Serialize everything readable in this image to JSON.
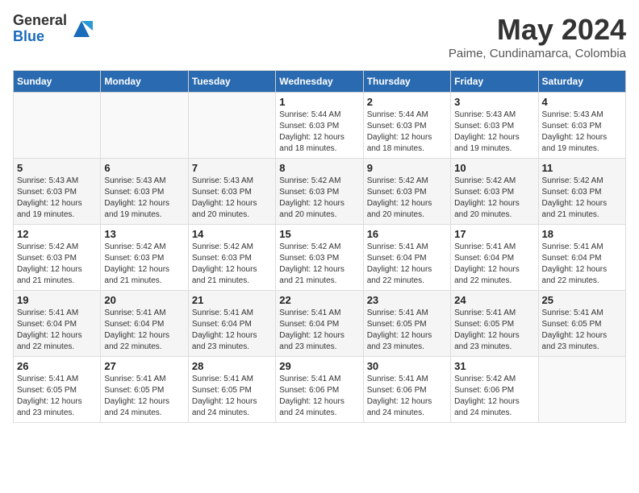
{
  "logo": {
    "general": "General",
    "blue": "Blue"
  },
  "header": {
    "month_year": "May 2024",
    "location": "Paime, Cundinamarca, Colombia"
  },
  "weekdays": [
    "Sunday",
    "Monday",
    "Tuesday",
    "Wednesday",
    "Thursday",
    "Friday",
    "Saturday"
  ],
  "weeks": [
    [
      {
        "day": "",
        "info": ""
      },
      {
        "day": "",
        "info": ""
      },
      {
        "day": "",
        "info": ""
      },
      {
        "day": "1",
        "info": "Sunrise: 5:44 AM\nSunset: 6:03 PM\nDaylight: 12 hours\nand 18 minutes."
      },
      {
        "day": "2",
        "info": "Sunrise: 5:44 AM\nSunset: 6:03 PM\nDaylight: 12 hours\nand 18 minutes."
      },
      {
        "day": "3",
        "info": "Sunrise: 5:43 AM\nSunset: 6:03 PM\nDaylight: 12 hours\nand 19 minutes."
      },
      {
        "day": "4",
        "info": "Sunrise: 5:43 AM\nSunset: 6:03 PM\nDaylight: 12 hours\nand 19 minutes."
      }
    ],
    [
      {
        "day": "5",
        "info": "Sunrise: 5:43 AM\nSunset: 6:03 PM\nDaylight: 12 hours\nand 19 minutes."
      },
      {
        "day": "6",
        "info": "Sunrise: 5:43 AM\nSunset: 6:03 PM\nDaylight: 12 hours\nand 19 minutes."
      },
      {
        "day": "7",
        "info": "Sunrise: 5:43 AM\nSunset: 6:03 PM\nDaylight: 12 hours\nand 20 minutes."
      },
      {
        "day": "8",
        "info": "Sunrise: 5:42 AM\nSunset: 6:03 PM\nDaylight: 12 hours\nand 20 minutes."
      },
      {
        "day": "9",
        "info": "Sunrise: 5:42 AM\nSunset: 6:03 PM\nDaylight: 12 hours\nand 20 minutes."
      },
      {
        "day": "10",
        "info": "Sunrise: 5:42 AM\nSunset: 6:03 PM\nDaylight: 12 hours\nand 20 minutes."
      },
      {
        "day": "11",
        "info": "Sunrise: 5:42 AM\nSunset: 6:03 PM\nDaylight: 12 hours\nand 21 minutes."
      }
    ],
    [
      {
        "day": "12",
        "info": "Sunrise: 5:42 AM\nSunset: 6:03 PM\nDaylight: 12 hours\nand 21 minutes."
      },
      {
        "day": "13",
        "info": "Sunrise: 5:42 AM\nSunset: 6:03 PM\nDaylight: 12 hours\nand 21 minutes."
      },
      {
        "day": "14",
        "info": "Sunrise: 5:42 AM\nSunset: 6:03 PM\nDaylight: 12 hours\nand 21 minutes."
      },
      {
        "day": "15",
        "info": "Sunrise: 5:42 AM\nSunset: 6:03 PM\nDaylight: 12 hours\nand 21 minutes."
      },
      {
        "day": "16",
        "info": "Sunrise: 5:41 AM\nSunset: 6:04 PM\nDaylight: 12 hours\nand 22 minutes."
      },
      {
        "day": "17",
        "info": "Sunrise: 5:41 AM\nSunset: 6:04 PM\nDaylight: 12 hours\nand 22 minutes."
      },
      {
        "day": "18",
        "info": "Sunrise: 5:41 AM\nSunset: 6:04 PM\nDaylight: 12 hours\nand 22 minutes."
      }
    ],
    [
      {
        "day": "19",
        "info": "Sunrise: 5:41 AM\nSunset: 6:04 PM\nDaylight: 12 hours\nand 22 minutes."
      },
      {
        "day": "20",
        "info": "Sunrise: 5:41 AM\nSunset: 6:04 PM\nDaylight: 12 hours\nand 22 minutes."
      },
      {
        "day": "21",
        "info": "Sunrise: 5:41 AM\nSunset: 6:04 PM\nDaylight: 12 hours\nand 23 minutes."
      },
      {
        "day": "22",
        "info": "Sunrise: 5:41 AM\nSunset: 6:04 PM\nDaylight: 12 hours\nand 23 minutes."
      },
      {
        "day": "23",
        "info": "Sunrise: 5:41 AM\nSunset: 6:05 PM\nDaylight: 12 hours\nand 23 minutes."
      },
      {
        "day": "24",
        "info": "Sunrise: 5:41 AM\nSunset: 6:05 PM\nDaylight: 12 hours\nand 23 minutes."
      },
      {
        "day": "25",
        "info": "Sunrise: 5:41 AM\nSunset: 6:05 PM\nDaylight: 12 hours\nand 23 minutes."
      }
    ],
    [
      {
        "day": "26",
        "info": "Sunrise: 5:41 AM\nSunset: 6:05 PM\nDaylight: 12 hours\nand 23 minutes."
      },
      {
        "day": "27",
        "info": "Sunrise: 5:41 AM\nSunset: 6:05 PM\nDaylight: 12 hours\nand 24 minutes."
      },
      {
        "day": "28",
        "info": "Sunrise: 5:41 AM\nSunset: 6:05 PM\nDaylight: 12 hours\nand 24 minutes."
      },
      {
        "day": "29",
        "info": "Sunrise: 5:41 AM\nSunset: 6:06 PM\nDaylight: 12 hours\nand 24 minutes."
      },
      {
        "day": "30",
        "info": "Sunrise: 5:41 AM\nSunset: 6:06 PM\nDaylight: 12 hours\nand 24 minutes."
      },
      {
        "day": "31",
        "info": "Sunrise: 5:42 AM\nSunset: 6:06 PM\nDaylight: 12 hours\nand 24 minutes."
      },
      {
        "day": "",
        "info": ""
      }
    ]
  ]
}
